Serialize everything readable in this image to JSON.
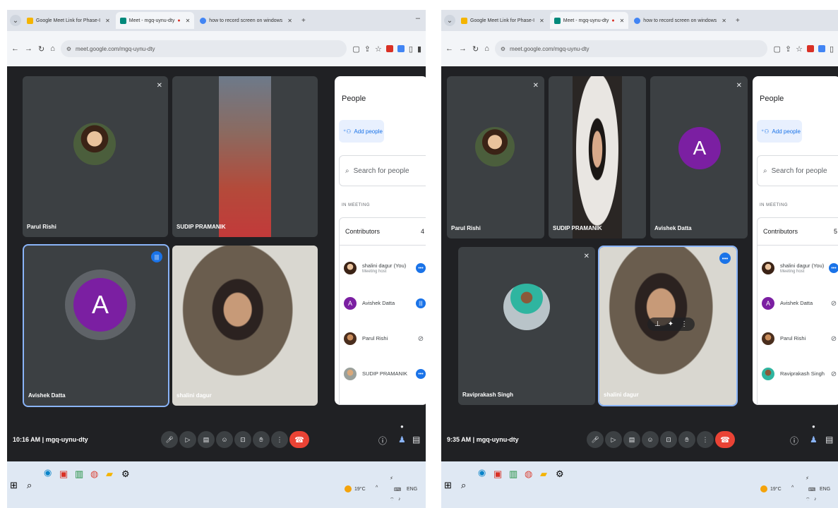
{
  "left": {
    "tabs": [
      {
        "label": "Google Meet Link for Phase-I",
        "fav_color": "#f4b400"
      },
      {
        "label": "Meet - mgq-uynu-dty",
        "fav_color": "#00897b"
      },
      {
        "label": "how to record screen on windows",
        "fav_color": "#4285f4"
      }
    ],
    "url": "meet.google.com/mgq-uynu-dty",
    "tiles": [
      {
        "name": "Parul Rishi"
      },
      {
        "name": "SUDIP PRAMANIK"
      },
      {
        "name": "Avishek Datta",
        "letter": "A"
      },
      {
        "name": "shalini dagur"
      }
    ],
    "people_panel": {
      "title": "People",
      "add_people": "Add people",
      "search_placeholder": "Search for people",
      "in_meeting": "IN MEETING",
      "contributors_label": "Contributors",
      "contributors_count": "4",
      "participants": [
        {
          "name": "shalini dagur (You)",
          "sub": "Meeting host"
        },
        {
          "name": "Avishek Datta",
          "sub": ""
        },
        {
          "name": "Parul Rishi",
          "sub": ""
        },
        {
          "name": "SUDIP PRAMANIK",
          "sub": ""
        }
      ]
    },
    "meeting_info": "10:16 AM | mgq-uynu-dty"
  },
  "right": {
    "tabs": [
      {
        "label": "Google Meet Link for Phase-I",
        "fav_color": "#f4b400"
      },
      {
        "label": "Meet - mgq-uynu-dty",
        "fav_color": "#00897b"
      },
      {
        "label": "how to record screen on windows",
        "fav_color": "#4285f4"
      }
    ],
    "url": "meet.google.com/mgq-uynu-dty",
    "tiles": [
      {
        "name": "Parul Rishi"
      },
      {
        "name": "SUDIP PRAMANIK"
      },
      {
        "name": "Avishek Datta",
        "letter": "A"
      },
      {
        "name": "Raviprakash Singh"
      },
      {
        "name": "shalini dagur"
      }
    ],
    "people_panel": {
      "title": "People",
      "add_people": "Add people",
      "search_placeholder": "Search for people",
      "in_meeting": "IN MEETING",
      "contributors_label": "Contributors",
      "contributors_count": "5",
      "participants": [
        {
          "name": "shalini dagur (You)",
          "sub": "Meeting host"
        },
        {
          "name": "Avishek Datta",
          "sub": ""
        },
        {
          "name": "Parul Rishi",
          "sub": ""
        },
        {
          "name": "Raviprakash Singh",
          "sub": ""
        }
      ]
    },
    "meeting_info": "9:35 AM | mgq-uynu-dty"
  },
  "taskbar": {
    "weather": "19°C",
    "language": "ENG"
  },
  "colors": {
    "meet_bg": "#202124",
    "tile_bg": "#3c4043",
    "avatar_purple": "#7b1fa2",
    "end_call_red": "#ea4335",
    "active_blue": "#1a73e8"
  }
}
